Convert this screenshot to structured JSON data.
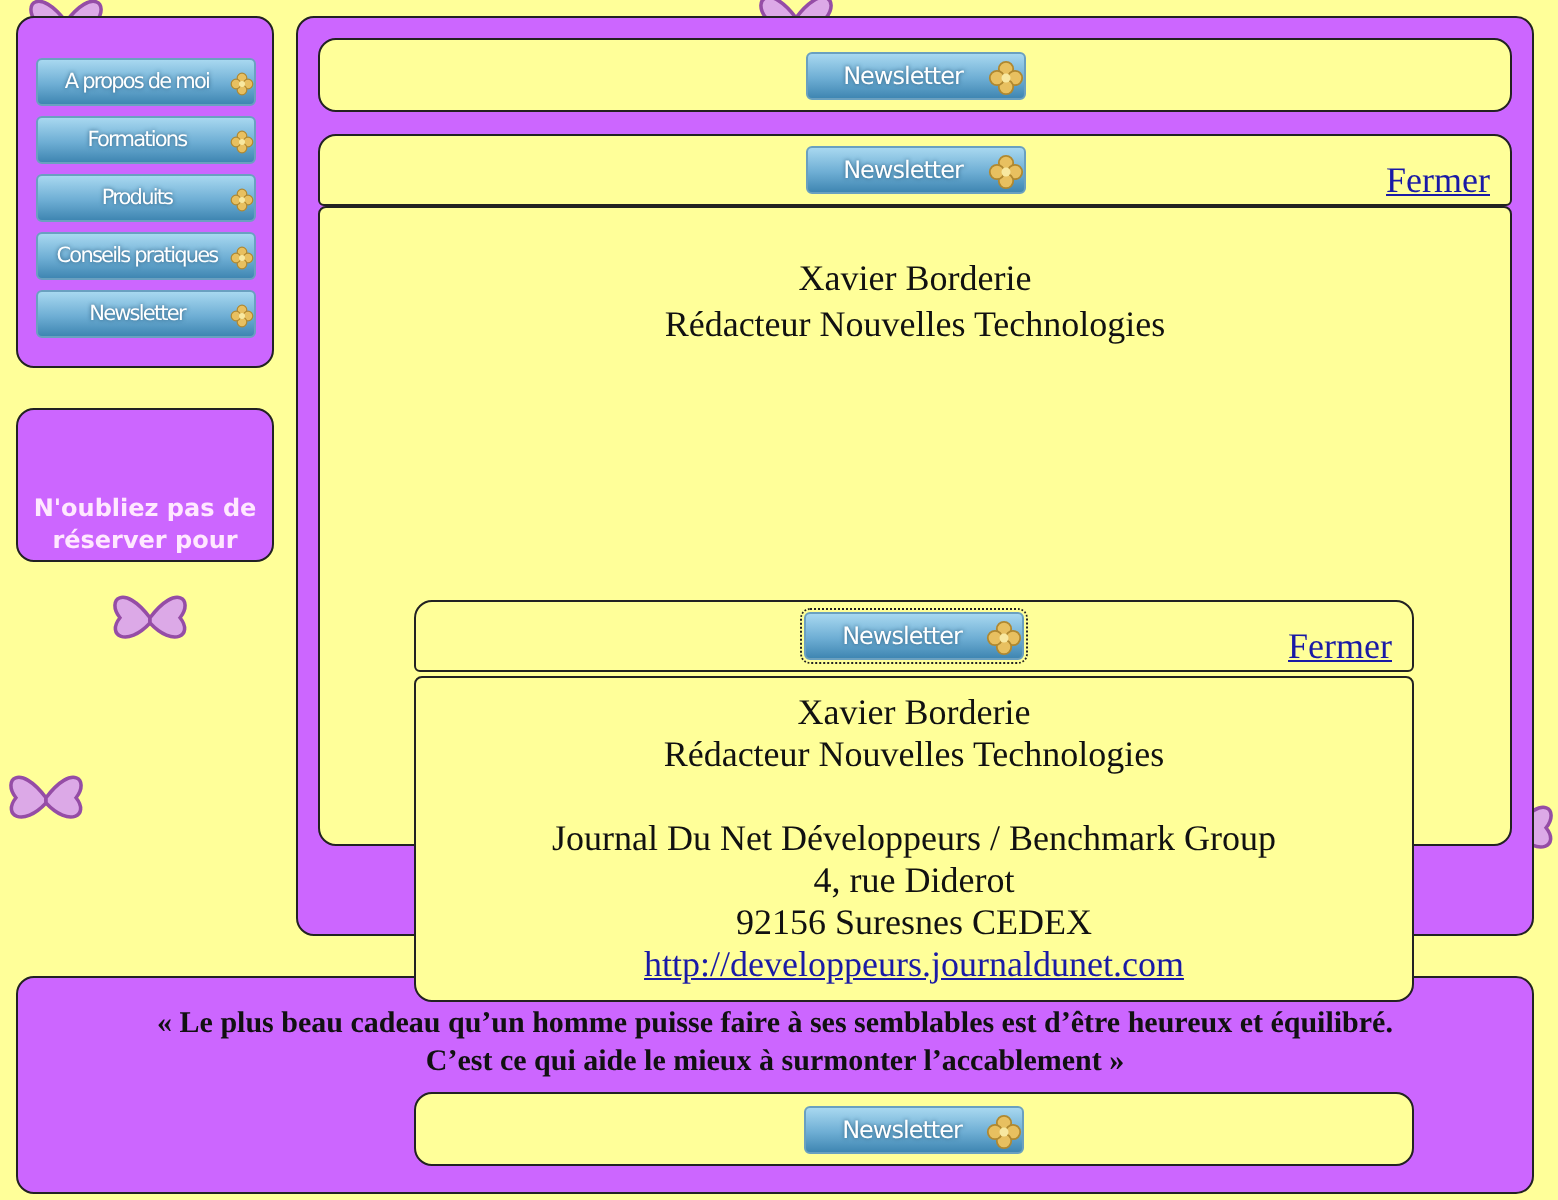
{
  "nav": [
    {
      "label": "A propos de moi"
    },
    {
      "label": "Formations"
    },
    {
      "label": "Produits"
    },
    {
      "label": "Conseils pratiques"
    },
    {
      "label": "Newsletter"
    }
  ],
  "reminder": "N'oubliez pas de réserver pour",
  "main": {
    "top_bar": {
      "button": "Newsletter",
      "focused": false
    },
    "popup": {
      "button": "Newsletter",
      "focused": false,
      "close": "Fermer",
      "lines": [
        "Xavier Borderie",
        "Rédacteur Nouvelles Technologies"
      ]
    }
  },
  "overlay_popup": {
    "button": "Newsletter",
    "focused": true,
    "close": "Fermer",
    "name_lines": [
      "Xavier Borderie",
      "Rédacteur Nouvelles Technologies"
    ],
    "address_lines": [
      "Journal Du Net Développeurs / Benchmark Group",
      "4, rue Diderot",
      "92156 Suresnes CEDEX"
    ],
    "link": "http://developpeurs.journaldunet.com"
  },
  "footer": {
    "quote_lines": [
      "« Le plus beau cadeau qu’un homme puisse faire à ses semblables est d’être heureux et équilibré.",
      "C’est ce qui aide le mieux à surmonter l’accablement »"
    ],
    "button": "Newsletter",
    "focused": false
  }
}
